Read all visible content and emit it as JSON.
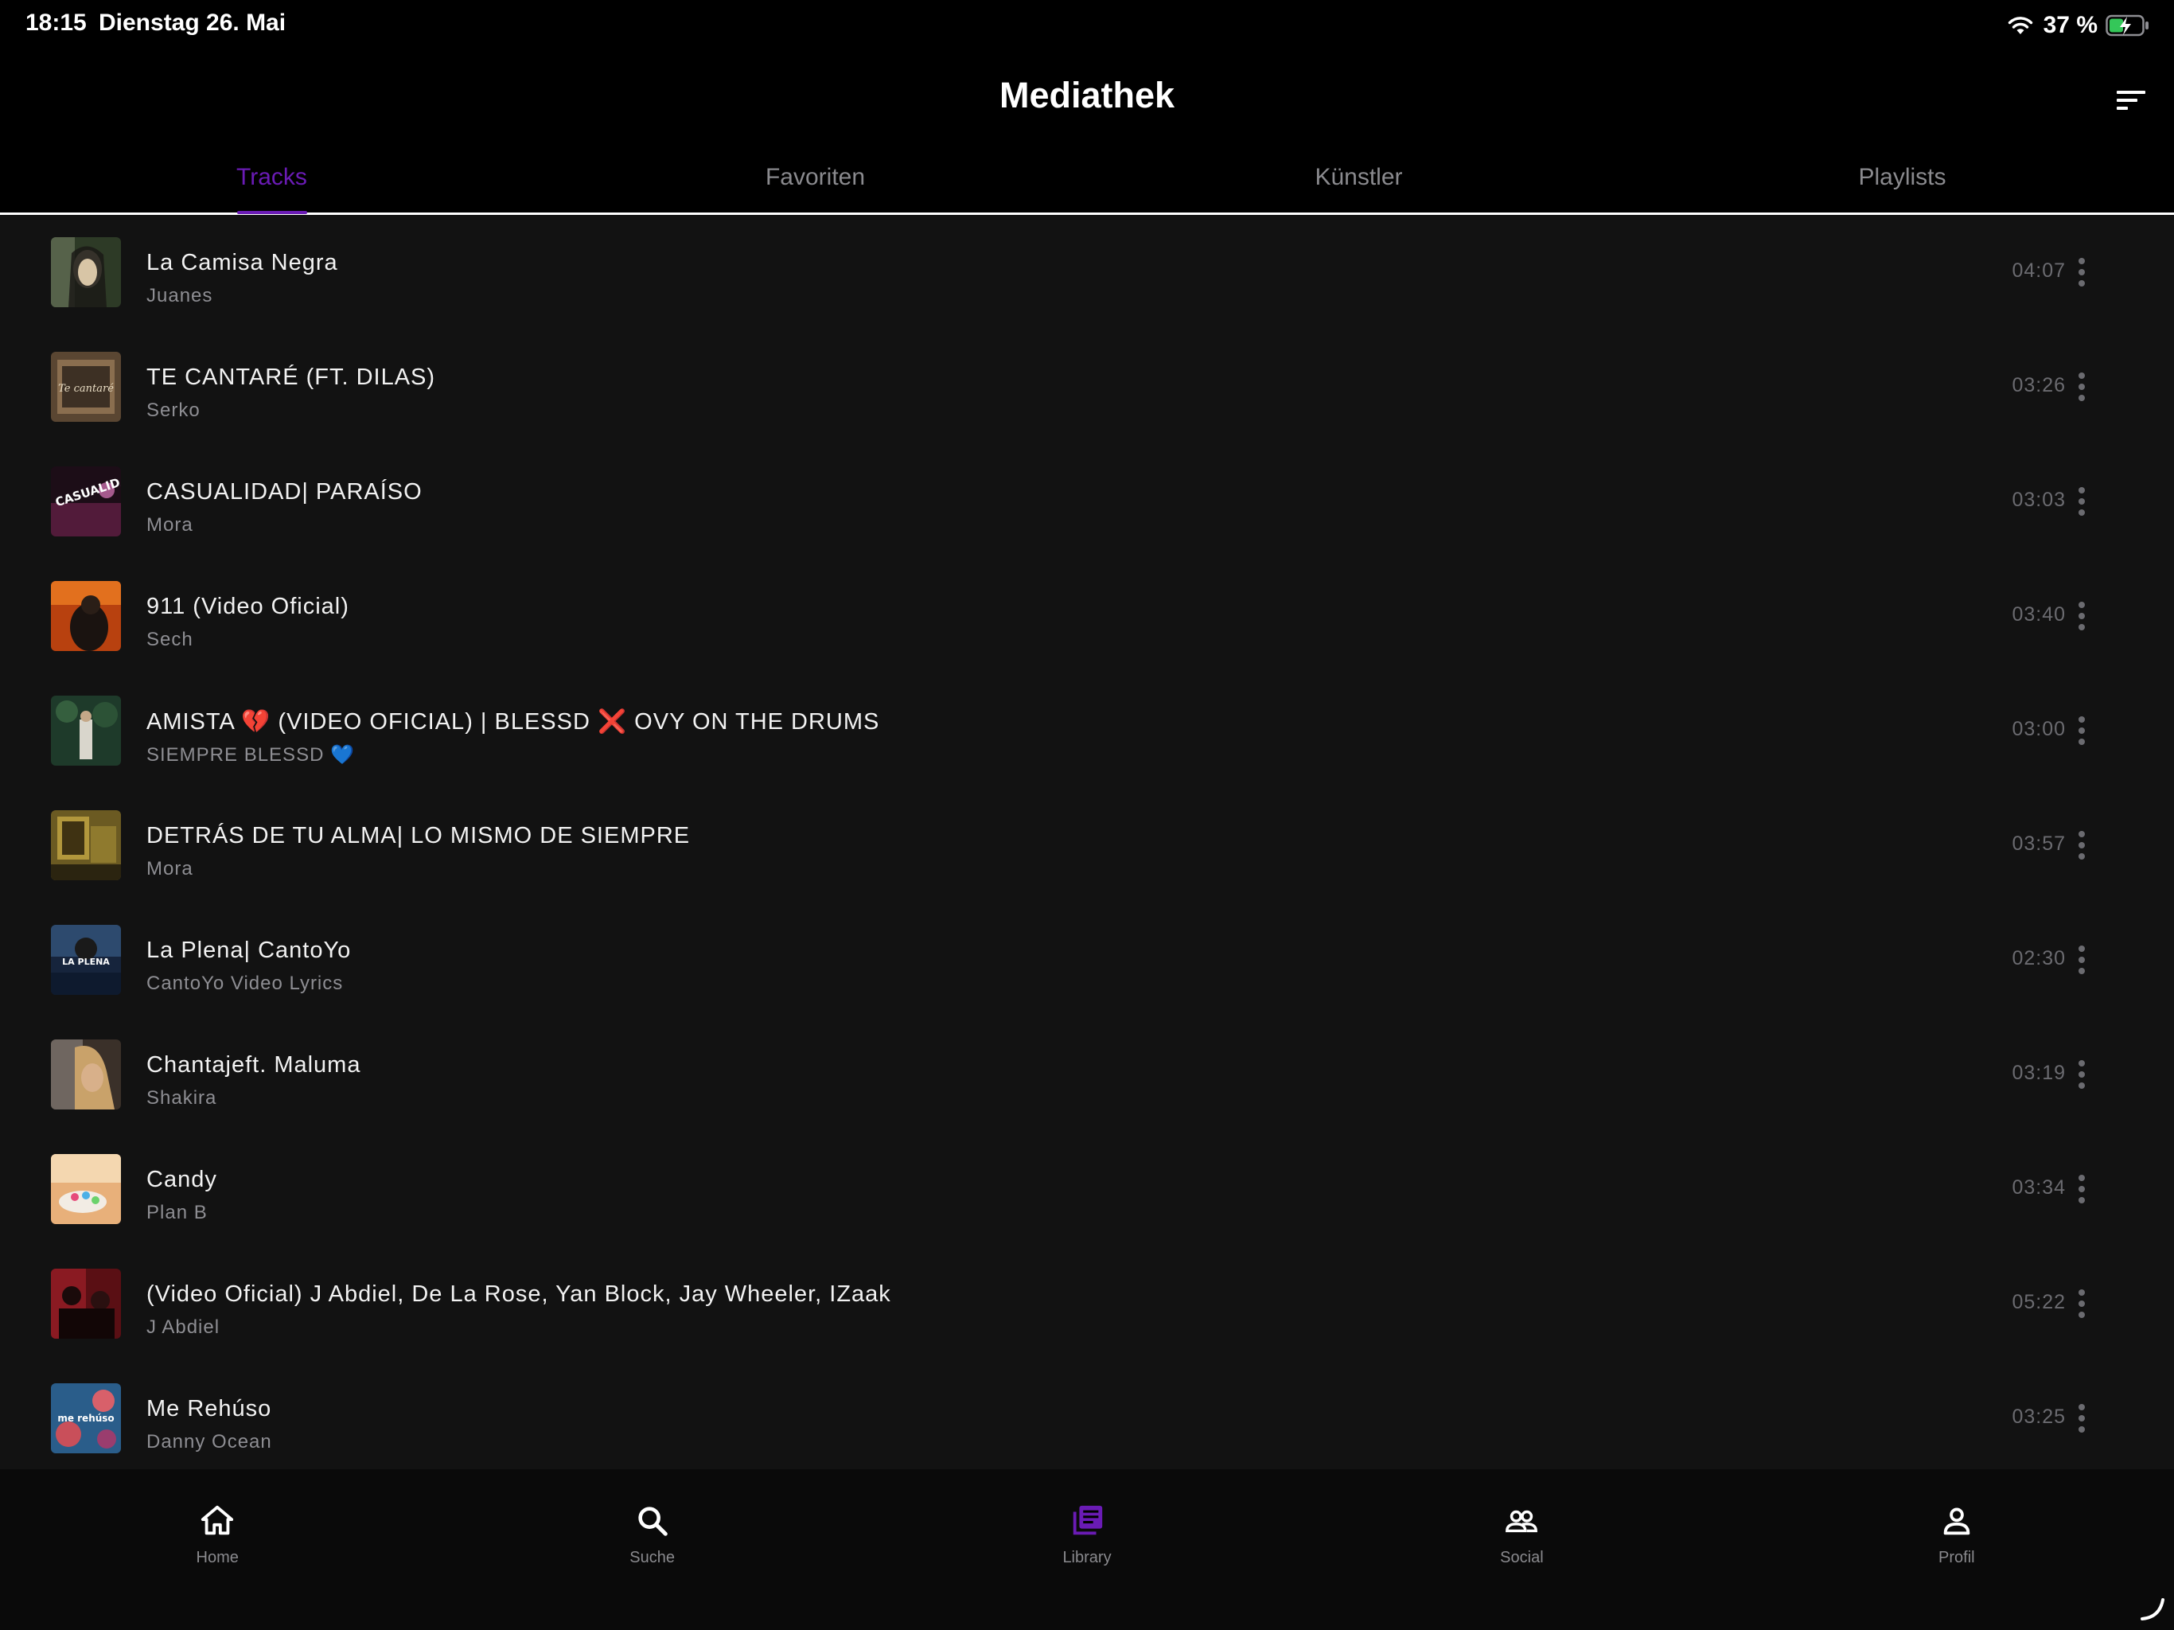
{
  "status_bar": {
    "time": "18:15",
    "date": "Dienstag 26. Mai",
    "battery": "37 %"
  },
  "header": {
    "title": "Mediathek"
  },
  "tabs": [
    {
      "label": "Tracks",
      "active": true
    },
    {
      "label": "Favoriten",
      "active": false
    },
    {
      "label": "Künstler",
      "active": false
    },
    {
      "label": "Playlists",
      "active": false
    }
  ],
  "tracks": [
    {
      "title": "La Camisa Negra",
      "artist": "Juanes",
      "duration": "04:07"
    },
    {
      "title": "TE CANTARÉ (FT. DILAS)",
      "artist": "Serko",
      "duration": "03:26"
    },
    {
      "title": "CASUALIDAD| PARAÍSO",
      "artist": "Mora",
      "duration": "03:03"
    },
    {
      "title": "911 (Video Oficial)",
      "artist": "Sech",
      "duration": "03:40"
    },
    {
      "title_parts": [
        "AMISTA ",
        "💔",
        "  (VIDEO OFICIAL) | BLESSD ",
        "❌",
        "  OVY ON THE DRUMS"
      ],
      "artist_parts": [
        "SIEMPRE BLESSD ",
        "💙"
      ],
      "duration": "03:00"
    },
    {
      "title": "DETRÁS DE TU ALMA| LO MISMO DE SIEMPRE",
      "artist": "Mora",
      "duration": "03:57"
    },
    {
      "title": "La Plena| CantoYo",
      "artist": "CantoYo Video Lyrics",
      "duration": "02:30"
    },
    {
      "title": "Chantajeft. Maluma",
      "artist": "Shakira",
      "duration": "03:19"
    },
    {
      "title": "Candy",
      "artist": "Plan B",
      "duration": "03:34"
    },
    {
      "title": "(Video Oficial) J Abdiel, De La Rose, Yan Block, Jay Wheeler, IZaak",
      "artist": "J Abdiel",
      "duration": "05:22"
    },
    {
      "title": "Me Rehúso",
      "artist": "Danny Ocean",
      "duration": "03:25"
    }
  ],
  "covers": {
    "casualidad_text": "CASUALIDAD",
    "la_plena_text": "LA PLENA",
    "me_rehuso_text": "me rehúso",
    "te_cantare_text": "Te cantaré"
  },
  "bottom_nav": [
    {
      "label": "Home",
      "icon": "home-icon"
    },
    {
      "label": "Suche",
      "icon": "search-icon"
    },
    {
      "label": "Library",
      "icon": "library-icon"
    },
    {
      "label": "Social",
      "icon": "social-icon"
    },
    {
      "label": "Profil",
      "icon": "profile-icon"
    }
  ],
  "colors": {
    "accent": "#6a1bb5",
    "background": "#000000",
    "list_background": "#121212",
    "secondary_text": "#8e8e93"
  }
}
